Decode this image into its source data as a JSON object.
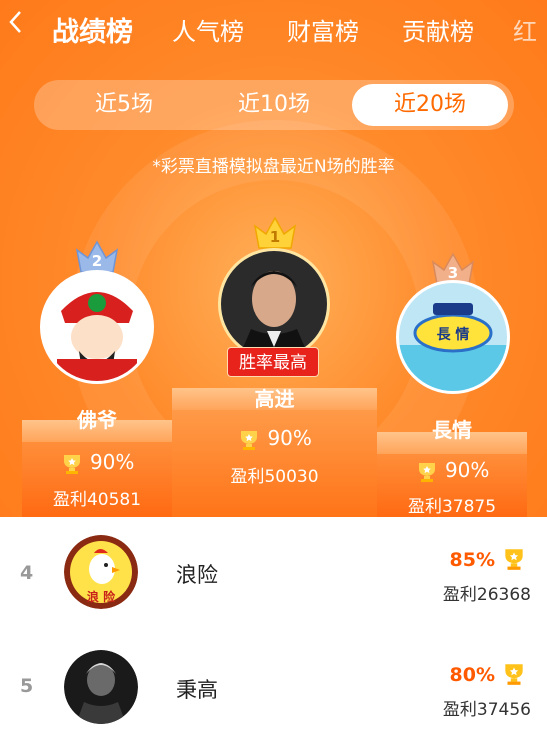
{
  "nav": {
    "back_icon": "chevron-left-icon",
    "tabs": [
      {
        "label": "战绩榜",
        "active": true
      },
      {
        "label": "人气榜",
        "active": false
      },
      {
        "label": "财富榜",
        "active": false
      },
      {
        "label": "贡献榜",
        "active": false
      },
      {
        "label": "红",
        "active": false
      }
    ]
  },
  "segment": {
    "options": [
      "近5场",
      "近10场",
      "近20场"
    ],
    "selected": "近20场"
  },
  "subtitle": "*彩票直播模拟盘最近N场的胜率",
  "podium": {
    "first": {
      "rank": "1",
      "name": "高进",
      "rate": "90%",
      "profit": "盈利50030",
      "badge": "胜率最高"
    },
    "second": {
      "rank": "2",
      "name": "佛爷",
      "rate": "90%",
      "profit": "盈利40581"
    },
    "third": {
      "rank": "3",
      "name": "長情",
      "rate": "90%",
      "profit": "盈利37875"
    }
  },
  "list": [
    {
      "rank": "4",
      "name": "浪险",
      "rate": "85%",
      "profit": "盈利26368"
    },
    {
      "rank": "5",
      "name": "秉高",
      "rate": "80%",
      "profit": "盈利37456"
    }
  ],
  "colors": {
    "accent": "#ff6a00",
    "badge": "#e8231b",
    "rate_text": "#ff5a00"
  }
}
